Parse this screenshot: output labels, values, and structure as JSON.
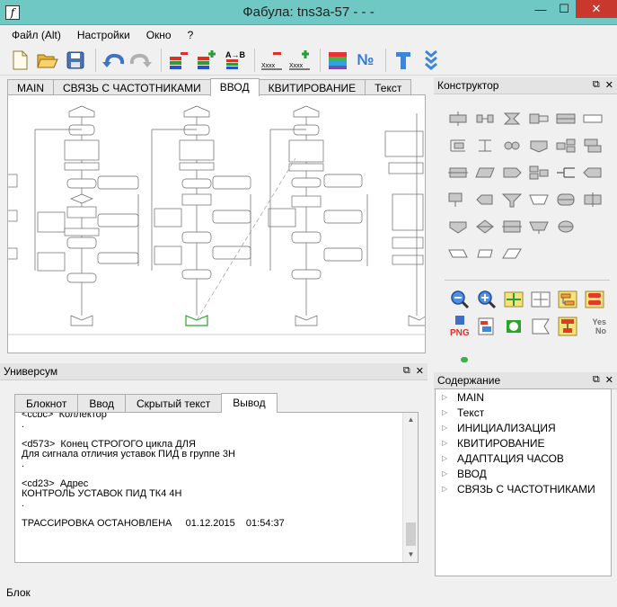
{
  "window": {
    "title": "Фабула: tns3a-57 - - -",
    "logo_letter": "f",
    "minimize": "—",
    "maximize": "☐",
    "close": "✕"
  },
  "menu": [
    "Файл (Alt)",
    "Настройки",
    "Окно",
    "?"
  ],
  "toolbar": {
    "buttons": [
      "new-file",
      "open-folder",
      "save",
      "undo",
      "redo",
      "delete-stack",
      "add-stack",
      "swap-ab",
      "remove-xxxx",
      "add-xxxx",
      "color-palette",
      "numbering",
      "text-tool",
      "collapse"
    ],
    "label_ab": "A→B",
    "label_xxxx": "Xxxx",
    "label_numero": "№"
  },
  "editor_tabs": [
    {
      "label": "MAIN",
      "active": false
    },
    {
      "label": "СВЯЗЬ С ЧАСТОТНИКАМИ",
      "active": false
    },
    {
      "label": "ВВОД",
      "active": true
    },
    {
      "label": "КВИТИРОВАНИЕ",
      "active": false
    },
    {
      "label": "Текст",
      "active": false
    }
  ],
  "constructor": {
    "title": "Конструктор",
    "float_icon": "⧉",
    "close_icon": "✕",
    "export_label": "PNG",
    "yes_label": "Yes",
    "no_label": "No"
  },
  "universum": {
    "title": "Универсум",
    "float_icon": "⧉",
    "close_icon": "✕",
    "tabs": [
      {
        "label": "Блокнот",
        "active": false
      },
      {
        "label": "Ввод",
        "active": false
      },
      {
        "label": "Скрытый текст",
        "active": false
      },
      {
        "label": "Вывод",
        "active": true
      }
    ],
    "output_lines": [
      "<ccbc>  Коллектор",
      ".",
      "",
      "<d573>  Конец СТРОГОГО цикла ДЛЯ",
      "Для сигнала отличия уставок ПИД в группе 3Н",
      ".",
      "",
      "<cd23>  Адрес",
      "КОНТРОЛЬ УСТАВОК ПИД ТК4 4Н",
      ".",
      "",
      "ТРАССИРОВКА ОСТАНОВЛЕНА     01.12.2015    01:54:37"
    ],
    "scroll_up": "▲",
    "scroll_down": "▼"
  },
  "contents": {
    "title": "Содержание",
    "float_icon": "⧉",
    "close_icon": "✕",
    "items": [
      "MAIN",
      "Текст",
      "ИНИЦИАЛИЗАЦИЯ",
      "КВИТИРОВАНИЕ",
      "АДАПТАЦИЯ ЧАСОВ",
      "ВВОД",
      "СВЯЗЬ С ЧАСТОТНИКАМИ"
    ],
    "expand_icon": "▷"
  },
  "status": {
    "text": "Блок"
  },
  "colors": {
    "titlebar": "#6fc8c4",
    "close_btn": "#c8382d",
    "shape_stroke": "#707070",
    "shape_fill": "#c8c8c8"
  }
}
